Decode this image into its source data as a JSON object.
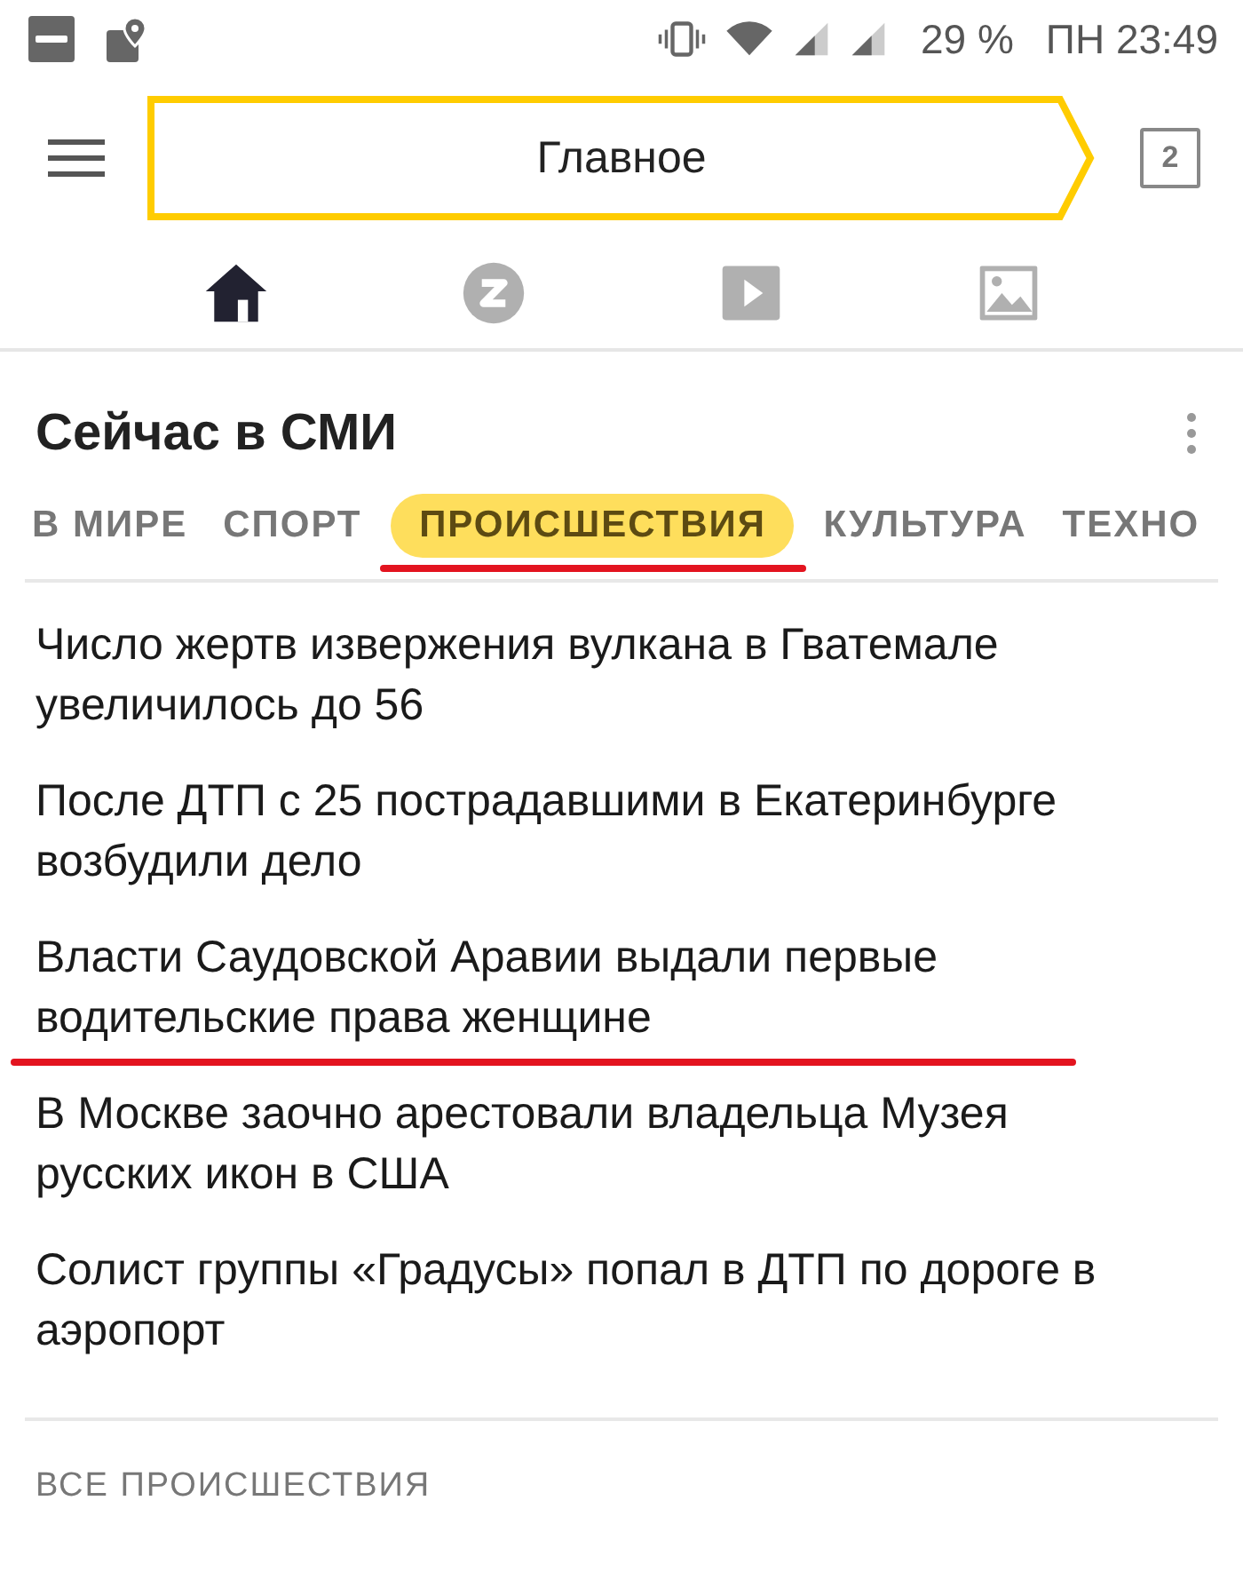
{
  "status_bar": {
    "battery": "29 %",
    "time": "ПН 23:49"
  },
  "header": {
    "title": "Главное",
    "tab_count": "2"
  },
  "nav": [
    {
      "kind": "home",
      "selected": true
    },
    {
      "kind": "zen",
      "selected": false
    },
    {
      "kind": "video",
      "selected": false
    },
    {
      "kind": "images",
      "selected": false
    }
  ],
  "card": {
    "title": "Сейчас в СМИ",
    "tabs": [
      {
        "label": "В МИРЕ",
        "selected": false
      },
      {
        "label": "СПОРТ",
        "selected": false
      },
      {
        "label": "ПРОИСШЕСТВИЯ",
        "selected": true
      },
      {
        "label": "КУЛЬТУРА",
        "selected": false
      },
      {
        "label": "ТЕХНО",
        "selected": false
      }
    ],
    "news": [
      {
        "text": "Число жертв извержения вулкана в Гватемале увеличилось до 56",
        "underlined": false
      },
      {
        "text": "После ДТП с 25 пострадавшими в Екатеринбурге возбудили дело",
        "underlined": false
      },
      {
        "text": "Власти Саудовской Аравии выдали первые водительские права женщине",
        "underlined": true
      },
      {
        "text": "В Москве заочно арестовали владельца Музея русских икон в США",
        "underlined": false
      },
      {
        "text": "Солист группы «Градусы» попал в ДТП по дороге в аэропорт",
        "underlined": false
      }
    ],
    "footer_link": "ВСЕ ПРОИСШЕСТВИЯ"
  }
}
